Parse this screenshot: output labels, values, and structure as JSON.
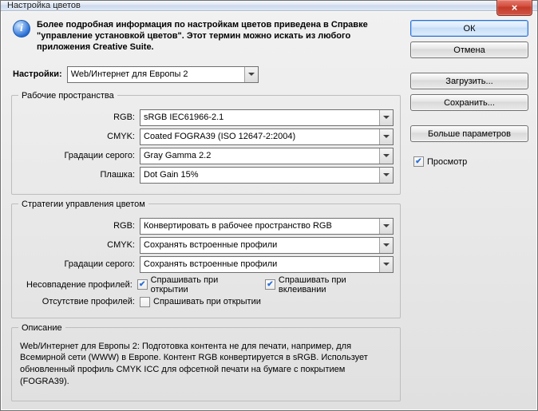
{
  "window": {
    "title": "Настройка цветов",
    "close_glyph": "×"
  },
  "info": {
    "glyph": "i",
    "text": "Более подробная информация по настройкам цветов приведена в Справке \"управление установкой цветов\". Этот термин можно искать из любого приложения Creative Suite."
  },
  "settings": {
    "label": "Настройки:",
    "value": "Web/Интернет для Европы 2"
  },
  "workspaces": {
    "legend": "Рабочие пространства",
    "rgb_label": "RGB:",
    "rgb_value": "sRGB IEC61966-2.1",
    "cmyk_label": "CMYK:",
    "cmyk_value": "Coated FOGRA39 (ISO 12647-2:2004)",
    "gray_label": "Градации серого:",
    "gray_value": "Gray Gamma 2.2",
    "spot_label": "Плашка:",
    "spot_value": "Dot Gain 15%"
  },
  "policies": {
    "legend": "Стратегии управления цветом",
    "rgb_label": "RGB:",
    "rgb_value": "Конвертировать в рабочее пространство RGB",
    "cmyk_label": "CMYK:",
    "cmyk_value": "Сохранять встроенные профили",
    "gray_label": "Градации серого:",
    "gray_value": "Сохранять встроенные профили",
    "mismatch_label": "Несовпадение профилей:",
    "ask_open": "Спрашивать при открытии",
    "ask_paste": "Спрашивать при вклеивании",
    "missing_label": "Отсутствие профилей:"
  },
  "description": {
    "legend": "Описание",
    "text": "Web/Интернет для Европы 2:   Подготовка контента не для печати, например, для Всемирной сети (WWW) в Европе. Контент RGB конвертируется в sRGB. Использует обновленный профиль CMYK ICC для офсетной печати на бумаге с покрытием (FOGRA39)."
  },
  "buttons": {
    "ok": "ОК",
    "cancel": "Отмена",
    "load": "Загрузить...",
    "save": "Сохранить...",
    "more": "Больше параметров",
    "preview": "Просмотр"
  }
}
